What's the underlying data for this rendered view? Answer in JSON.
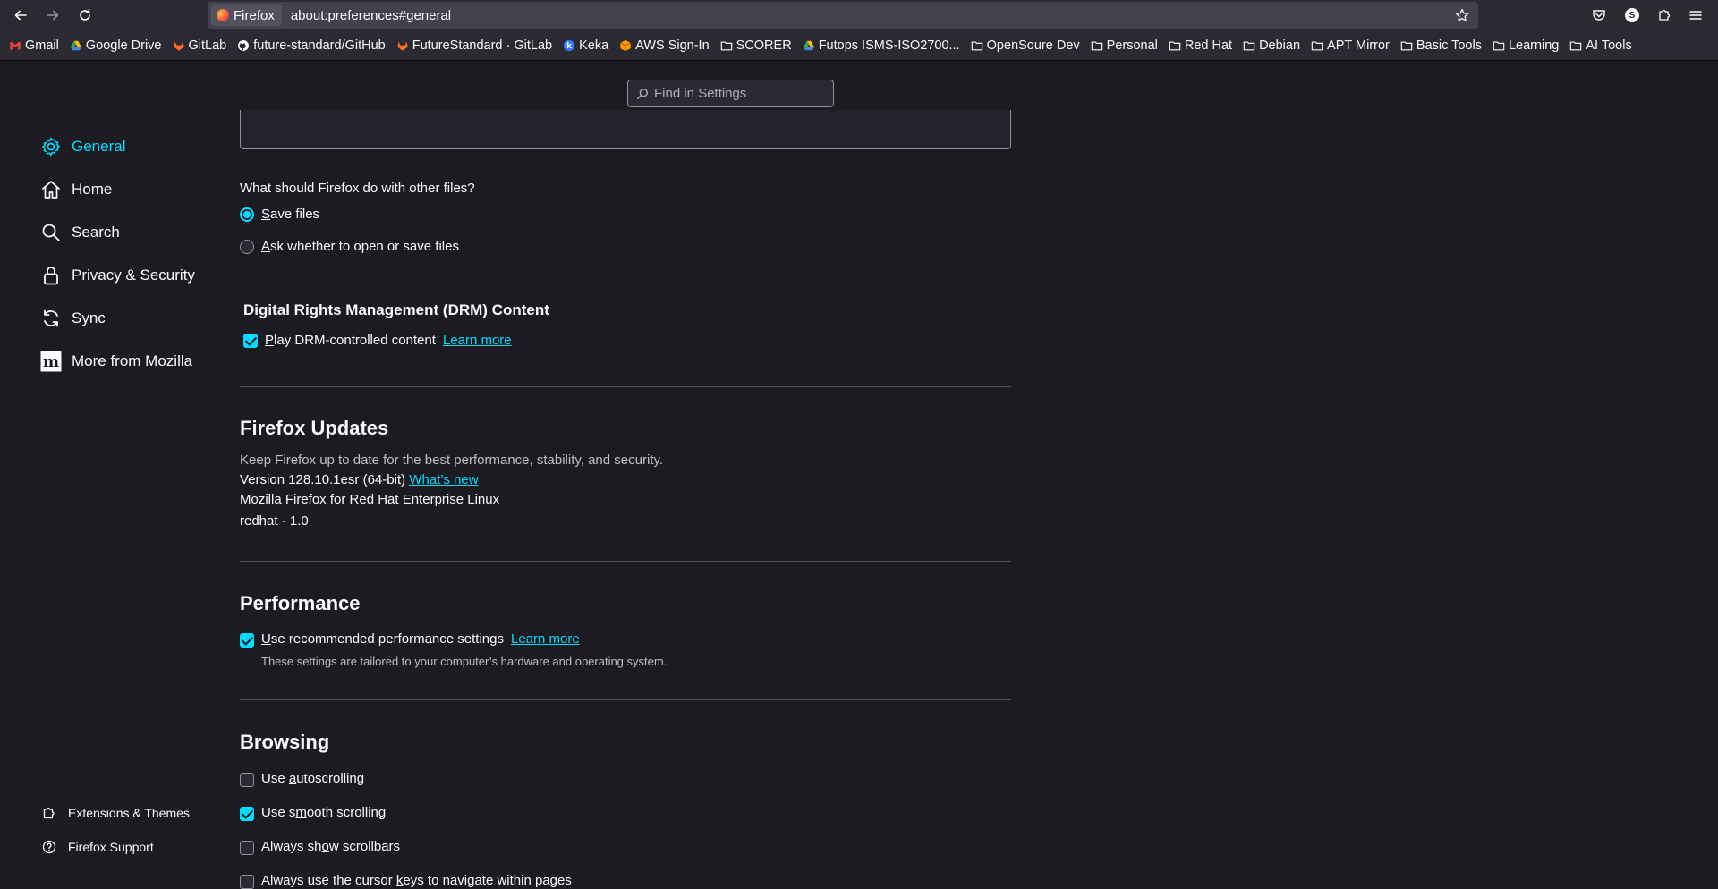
{
  "toolbar": {
    "identity_label": "Firefox",
    "url": "about:preferences#general",
    "profile_initial": "S"
  },
  "bookmarks": [
    {
      "label": "Gmail",
      "icon": "gmail-icon",
      "color": "#ea4335"
    },
    {
      "label": "Google Drive",
      "icon": "google-drive-icon",
      "color": "#fbbc04"
    },
    {
      "label": "GitLab",
      "icon": "gitlab-icon",
      "color": "#fc6d26"
    },
    {
      "label": "future-standard/GitHub",
      "icon": "github-icon",
      "color": "#fbfbfe"
    },
    {
      "label": "FutureStandard · GitLab",
      "icon": "gitlab-icon",
      "color": "#fc6d26"
    },
    {
      "label": "Keka",
      "icon": "keka-icon",
      "color": "#2f7bff"
    },
    {
      "label": "AWS Sign-In",
      "icon": "aws-icon",
      "color": "#ff9900"
    },
    {
      "label": "SCORER",
      "icon": "folder-icon",
      "color": "#fbfbfe"
    },
    {
      "label": "Futops ISMS-ISO2700...",
      "icon": "google-drive-icon",
      "color": "#fbbc04"
    },
    {
      "label": "OpenSoure Dev",
      "icon": "folder-icon",
      "color": "#fbfbfe"
    },
    {
      "label": "Personal",
      "icon": "folder-icon",
      "color": "#fbfbfe"
    },
    {
      "label": "Red Hat",
      "icon": "folder-icon",
      "color": "#fbfbfe"
    },
    {
      "label": "Debian",
      "icon": "folder-icon",
      "color": "#fbfbfe"
    },
    {
      "label": "APT Mirror",
      "icon": "folder-icon",
      "color": "#fbfbfe"
    },
    {
      "label": "Basic Tools",
      "icon": "folder-icon",
      "color": "#fbfbfe"
    },
    {
      "label": "Learning",
      "icon": "folder-icon",
      "color": "#fbfbfe"
    },
    {
      "label": "AI Tools",
      "icon": "folder-icon",
      "color": "#fbfbfe"
    }
  ],
  "search": {
    "placeholder": "Find in Settings"
  },
  "sidebar": {
    "categories": [
      {
        "label": "General",
        "icon": "gear-icon",
        "selected": true
      },
      {
        "label": "Home",
        "icon": "home-icon"
      },
      {
        "label": "Search",
        "icon": "search-icon"
      },
      {
        "label": "Privacy & Security",
        "icon": "lock-icon"
      },
      {
        "label": "Sync",
        "icon": "sync-icon"
      },
      {
        "label": "More from Mozilla",
        "icon": "mozilla-icon"
      }
    ],
    "footer": [
      {
        "label": "Extensions & Themes",
        "icon": "puzzle-icon"
      },
      {
        "label": "Firefox Support",
        "icon": "help-icon"
      }
    ]
  },
  "downloads": {
    "question": "What should Firefox do with other files?",
    "save_first": "S",
    "save_rest": "ave files",
    "ask_first": "A",
    "ask_rest": "sk whether to open or save files",
    "selected": "save"
  },
  "drm": {
    "heading": "Digital Rights Management (DRM) Content",
    "check_first": "P",
    "check_rest": "lay DRM-controlled content",
    "checked": true,
    "learn_more": "Learn more"
  },
  "updates": {
    "heading": "Firefox Updates",
    "description": "Keep Firefox up to date for the best performance, stability, and security.",
    "version": "Version 128.10.1esr (64-bit)",
    "whats_new": "What’s new",
    "distribution": "Mozilla Firefox for Red Hat Enterprise Linux",
    "distribution_id": "redhat - 1.0"
  },
  "performance": {
    "heading": "Performance",
    "check_first": "U",
    "check_rest": "se recommended performance settings",
    "checked": true,
    "learn_more": "Learn more",
    "description": "These settings are tailored to your computer’s hardware and operating system."
  },
  "browsing": {
    "heading": "Browsing",
    "autoscroll_a": "Use ",
    "autoscroll_b": "a",
    "autoscroll_c": "utoscrolling",
    "autoscroll_checked": false,
    "smooth_a": "Use s",
    "smooth_b": "m",
    "smooth_c": "ooth scrolling",
    "smooth_checked": true,
    "scrollbars_a": "Always sh",
    "scrollbars_b": "o",
    "scrollbars_c": "w scrollbars",
    "scrollbars_checked": false,
    "cursor_a": "Always use the cursor ",
    "cursor_b": "k",
    "cursor_c": "eys to navigate within pages",
    "cursor_checked": false
  }
}
